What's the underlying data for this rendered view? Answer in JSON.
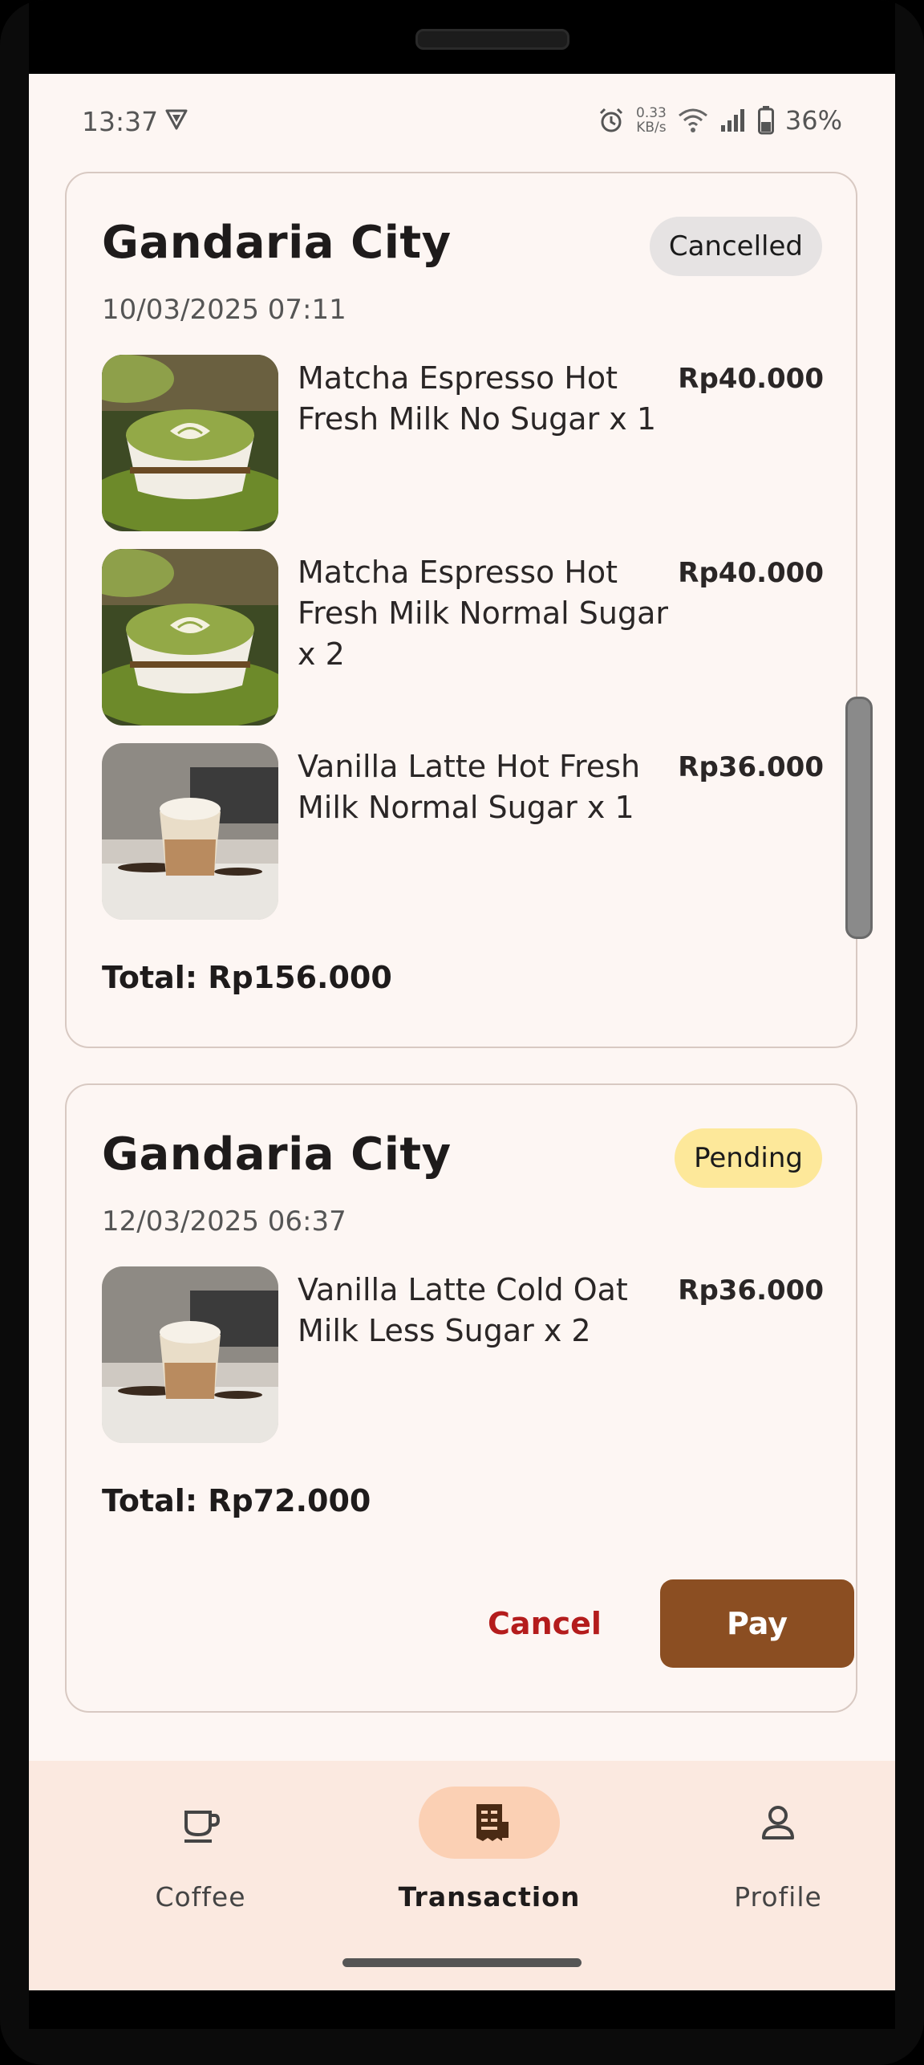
{
  "status_bar": {
    "time": "13:37",
    "net_speed_value": "0.33",
    "net_speed_unit": "KB/s",
    "battery": "36%"
  },
  "orders": [
    {
      "store": "Gandaria City",
      "status": "Cancelled",
      "date": "10/03/2025 07:11",
      "items": [
        {
          "name": "Matcha Espresso Hot Fresh Milk No Sugar x 1",
          "price": "Rp40.000",
          "image": "matcha-latte-photo"
        },
        {
          "name": "Matcha Espresso Hot Fresh Milk Normal Sugar x 2",
          "price": "Rp40.000",
          "image": "matcha-latte-photo"
        },
        {
          "name": "Vanilla Latte Hot Fresh Milk Normal Sugar x 1",
          "price": "Rp36.000",
          "image": "vanilla-latte-photo"
        }
      ],
      "total": "Total: Rp156.000"
    },
    {
      "store": "Gandaria City",
      "status": "Pending",
      "date": "12/03/2025 06:37",
      "items": [
        {
          "name": "Vanilla Latte Cold Oat Milk Less Sugar x 2",
          "price": "Rp36.000",
          "image": "vanilla-latte-photo"
        }
      ],
      "total": "Total: Rp72.000",
      "actions": {
        "cancel": "Cancel",
        "pay": "Pay"
      }
    }
  ],
  "bottom_nav": {
    "items": [
      {
        "label": "Coffee",
        "icon": "coffee-cup-icon",
        "active": false
      },
      {
        "label": "Transaction",
        "icon": "receipt-icon",
        "active": true
      },
      {
        "label": "Profile",
        "icon": "person-icon",
        "active": false
      }
    ]
  },
  "colors": {
    "background": "#fdf6f3",
    "card_border": "#d8c9c2",
    "badge_cancelled": "#e6e3e3",
    "badge_pending": "#fde89a",
    "pay_button": "#8b4e22",
    "cancel_text": "#b41c1c",
    "nav_background": "#fbe9e0",
    "nav_active_pill": "#fbd0b4"
  }
}
